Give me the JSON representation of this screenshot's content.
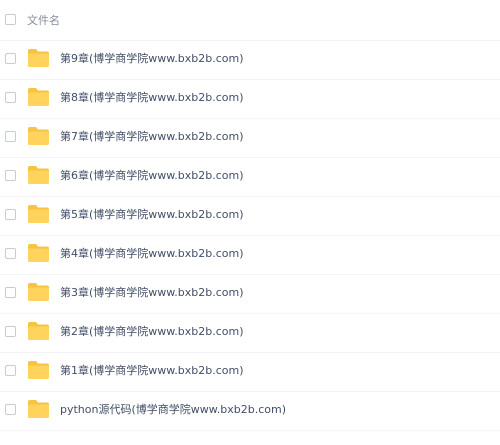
{
  "header": {
    "column_label": "文件名"
  },
  "files": [
    {
      "name": "第9章(博学商学院www.bxb2b.com)",
      "icon": "folder-icon"
    },
    {
      "name": "第8章(博学商学院www.bxb2b.com)",
      "icon": "folder-icon"
    },
    {
      "name": "第7章(博学商学院www.bxb2b.com)",
      "icon": "folder-icon"
    },
    {
      "name": "第6章(博学商学院www.bxb2b.com)",
      "icon": "folder-icon"
    },
    {
      "name": "第5章(博学商学院www.bxb2b.com)",
      "icon": "folder-icon"
    },
    {
      "name": "第4章(博学商学院www.bxb2b.com)",
      "icon": "folder-icon"
    },
    {
      "name": "第3章(博学商学院www.bxb2b.com)",
      "icon": "folder-icon"
    },
    {
      "name": "第2章(博学商学院www.bxb2b.com)",
      "icon": "folder-icon"
    },
    {
      "name": "第1章(博学商学院www.bxb2b.com)",
      "icon": "folder-icon"
    },
    {
      "name": "python源代码(博学商学院www.bxb2b.com)",
      "icon": "folder-icon"
    }
  ],
  "colors": {
    "folder_body": "#ffd35c",
    "folder_tab": "#f7c343",
    "text": "#424e67",
    "header_text": "#878c9c",
    "divider": "#f2f4f7",
    "checkbox_border": "#c7cbd3"
  }
}
